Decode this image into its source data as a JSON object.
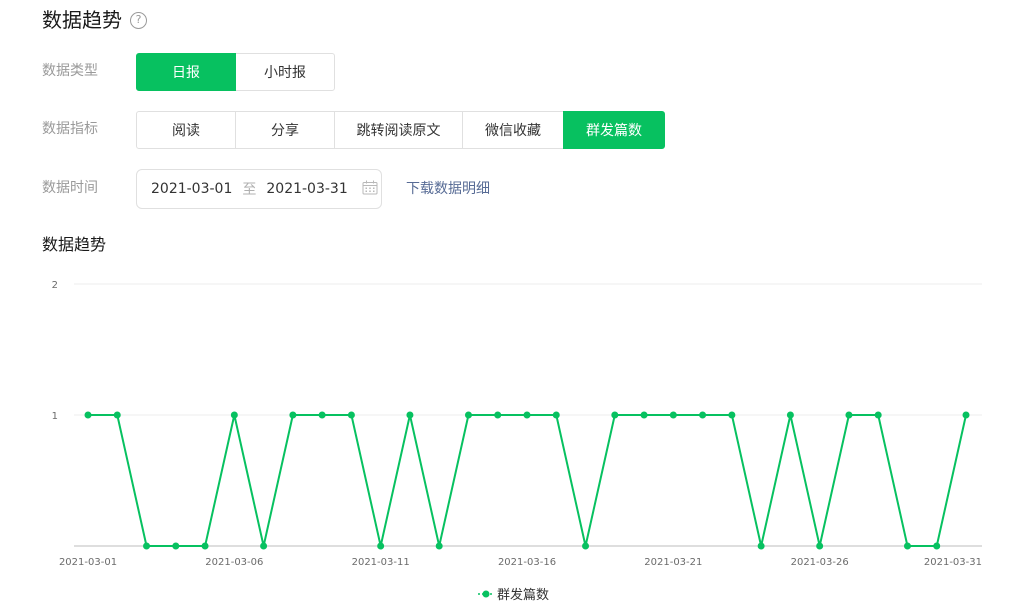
{
  "page": {
    "title": "数据趋势",
    "help_icon": "?"
  },
  "filters": {
    "type_label": "数据类型",
    "type_options": [
      "日报",
      "小时报"
    ],
    "type_selected": "日报",
    "metric_label": "数据指标",
    "metric_options": [
      "阅读",
      "分享",
      "跳转阅读原文",
      "微信收藏",
      "群发篇数"
    ],
    "metric_selected": "群发篇数",
    "time_label": "数据时间",
    "date_start": "2021-03-01",
    "date_separator": "至",
    "date_end": "2021-03-31",
    "calendar_icon": "calendar-icon",
    "download_label": "下载数据明细"
  },
  "section": {
    "title": "数据趋势"
  },
  "colors": {
    "accent": "#07c160",
    "link": "#576b95"
  },
  "chart_data": {
    "type": "line",
    "x": [
      "2021-03-01",
      "2021-03-02",
      "2021-03-03",
      "2021-03-04",
      "2021-03-05",
      "2021-03-06",
      "2021-03-07",
      "2021-03-08",
      "2021-03-09",
      "2021-03-10",
      "2021-03-11",
      "2021-03-12",
      "2021-03-13",
      "2021-03-14",
      "2021-03-15",
      "2021-03-16",
      "2021-03-17",
      "2021-03-18",
      "2021-03-19",
      "2021-03-20",
      "2021-03-21",
      "2021-03-22",
      "2021-03-23",
      "2021-03-24",
      "2021-03-25",
      "2021-03-26",
      "2021-03-27",
      "2021-03-28",
      "2021-03-29",
      "2021-03-30",
      "2021-03-31"
    ],
    "x_tick_labels": [
      "2021-03-01",
      "2021-03-06",
      "2021-03-11",
      "2021-03-16",
      "2021-03-21",
      "2021-03-26",
      "2021-03-31"
    ],
    "y_tick_labels": [
      "1",
      "2"
    ],
    "ylim": [
      0,
      2
    ],
    "series": [
      {
        "name": "群发篇数",
        "color": "#07c160",
        "values": [
          1,
          1,
          0,
          0,
          0,
          1,
          0,
          1,
          1,
          1,
          0,
          1,
          0,
          1,
          1,
          1,
          1,
          0,
          1,
          1,
          1,
          1,
          1,
          0,
          1,
          0,
          1,
          1,
          0,
          0,
          1
        ]
      }
    ],
    "legend": "bottom-center",
    "grid": true
  }
}
